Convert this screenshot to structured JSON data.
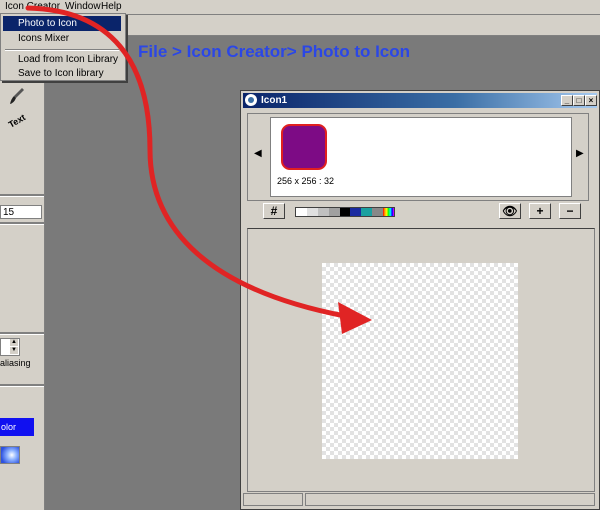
{
  "menubar": {
    "items": [
      "Icon Creator",
      "Window",
      "Help"
    ]
  },
  "dropdown": {
    "items": [
      "Photo to Icon",
      "Icons Mixer",
      "Load from Icon Library",
      "Save to Icon library"
    ],
    "selected": "Photo to Icon"
  },
  "caption": "File > Icon Creator> Photo to Icon",
  "left_panel": {
    "tool_label": "Text",
    "size_value": "15",
    "antialias_label": "aliasing",
    "color_button": "olor"
  },
  "window": {
    "title": "Icon1",
    "title_buttons": [
      "_",
      "□",
      "×"
    ],
    "icon_info": "256 x 256 : 32",
    "grid_icon": "grid-icon",
    "palette": [
      "#ffffff",
      "#e0e0e0",
      "#c0c0c0",
      "#a0a0a0",
      "#000000",
      "#1a2aa0",
      "#1aa0a0",
      "#888888",
      "rainbow"
    ],
    "icon_color": "#7d0b85",
    "icon_border": "#e02020"
  },
  "colors": {
    "accent": "#2b47e6",
    "arrow": "#e02424",
    "selected": "#0a246a"
  }
}
